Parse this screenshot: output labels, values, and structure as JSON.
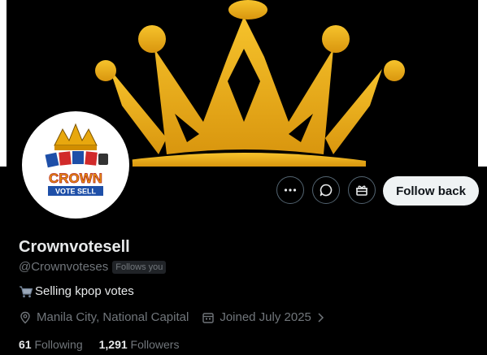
{
  "profile": {
    "display_name": "Crownvotesell",
    "handle": "@Crownvoteses",
    "follows_you_badge": "Follows you",
    "bio": "Selling kpop votes",
    "location": "Manila City, National Capital",
    "joined": "Joined July 2025",
    "following_count": "61",
    "following_label": "Following",
    "followers_count": "1,291",
    "followers_label": "Followers"
  },
  "avatar_logo": {
    "line1": "CROWN",
    "line2": "VOTE SELL"
  },
  "actions": {
    "more_icon": "more-icon",
    "message_icon": "message-icon",
    "gift_icon": "gift-icon",
    "follow_label": "Follow back"
  },
  "colors": {
    "background": "#000000",
    "crown_gold": "#e8b21e",
    "button_light": "#eff3f4",
    "muted_text": "#71767b"
  }
}
